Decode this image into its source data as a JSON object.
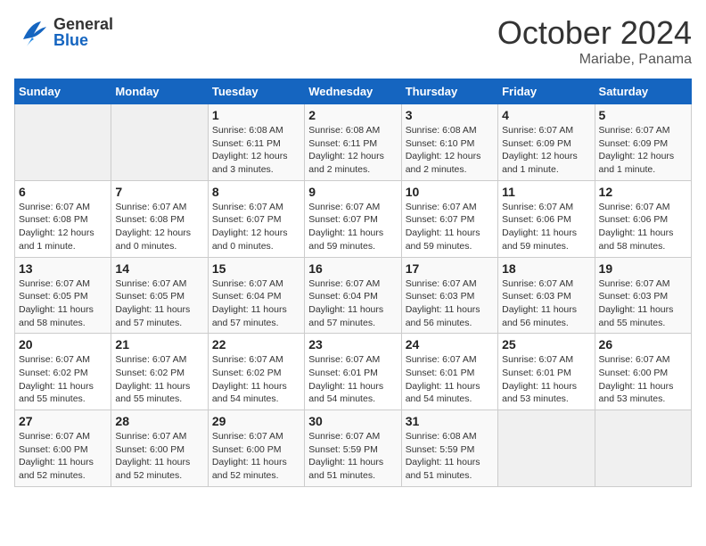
{
  "header": {
    "logo_general": "General",
    "logo_blue": "Blue",
    "month_title": "October 2024",
    "location": "Mariabe, Panama"
  },
  "days_of_week": [
    "Sunday",
    "Monday",
    "Tuesday",
    "Wednesday",
    "Thursday",
    "Friday",
    "Saturday"
  ],
  "weeks": [
    [
      {
        "day": "",
        "detail": ""
      },
      {
        "day": "",
        "detail": ""
      },
      {
        "day": "1",
        "detail": "Sunrise: 6:08 AM\nSunset: 6:11 PM\nDaylight: 12 hours\nand 3 minutes."
      },
      {
        "day": "2",
        "detail": "Sunrise: 6:08 AM\nSunset: 6:11 PM\nDaylight: 12 hours\nand 2 minutes."
      },
      {
        "day": "3",
        "detail": "Sunrise: 6:08 AM\nSunset: 6:10 PM\nDaylight: 12 hours\nand 2 minutes."
      },
      {
        "day": "4",
        "detail": "Sunrise: 6:07 AM\nSunset: 6:09 PM\nDaylight: 12 hours\nand 1 minute."
      },
      {
        "day": "5",
        "detail": "Sunrise: 6:07 AM\nSunset: 6:09 PM\nDaylight: 12 hours\nand 1 minute."
      }
    ],
    [
      {
        "day": "6",
        "detail": "Sunrise: 6:07 AM\nSunset: 6:08 PM\nDaylight: 12 hours\nand 1 minute."
      },
      {
        "day": "7",
        "detail": "Sunrise: 6:07 AM\nSunset: 6:08 PM\nDaylight: 12 hours\nand 0 minutes."
      },
      {
        "day": "8",
        "detail": "Sunrise: 6:07 AM\nSunset: 6:07 PM\nDaylight: 12 hours\nand 0 minutes."
      },
      {
        "day": "9",
        "detail": "Sunrise: 6:07 AM\nSunset: 6:07 PM\nDaylight: 11 hours\nand 59 minutes."
      },
      {
        "day": "10",
        "detail": "Sunrise: 6:07 AM\nSunset: 6:07 PM\nDaylight: 11 hours\nand 59 minutes."
      },
      {
        "day": "11",
        "detail": "Sunrise: 6:07 AM\nSunset: 6:06 PM\nDaylight: 11 hours\nand 59 minutes."
      },
      {
        "day": "12",
        "detail": "Sunrise: 6:07 AM\nSunset: 6:06 PM\nDaylight: 11 hours\nand 58 minutes."
      }
    ],
    [
      {
        "day": "13",
        "detail": "Sunrise: 6:07 AM\nSunset: 6:05 PM\nDaylight: 11 hours\nand 58 minutes."
      },
      {
        "day": "14",
        "detail": "Sunrise: 6:07 AM\nSunset: 6:05 PM\nDaylight: 11 hours\nand 57 minutes."
      },
      {
        "day": "15",
        "detail": "Sunrise: 6:07 AM\nSunset: 6:04 PM\nDaylight: 11 hours\nand 57 minutes."
      },
      {
        "day": "16",
        "detail": "Sunrise: 6:07 AM\nSunset: 6:04 PM\nDaylight: 11 hours\nand 57 minutes."
      },
      {
        "day": "17",
        "detail": "Sunrise: 6:07 AM\nSunset: 6:03 PM\nDaylight: 11 hours\nand 56 minutes."
      },
      {
        "day": "18",
        "detail": "Sunrise: 6:07 AM\nSunset: 6:03 PM\nDaylight: 11 hours\nand 56 minutes."
      },
      {
        "day": "19",
        "detail": "Sunrise: 6:07 AM\nSunset: 6:03 PM\nDaylight: 11 hours\nand 55 minutes."
      }
    ],
    [
      {
        "day": "20",
        "detail": "Sunrise: 6:07 AM\nSunset: 6:02 PM\nDaylight: 11 hours\nand 55 minutes."
      },
      {
        "day": "21",
        "detail": "Sunrise: 6:07 AM\nSunset: 6:02 PM\nDaylight: 11 hours\nand 55 minutes."
      },
      {
        "day": "22",
        "detail": "Sunrise: 6:07 AM\nSunset: 6:02 PM\nDaylight: 11 hours\nand 54 minutes."
      },
      {
        "day": "23",
        "detail": "Sunrise: 6:07 AM\nSunset: 6:01 PM\nDaylight: 11 hours\nand 54 minutes."
      },
      {
        "day": "24",
        "detail": "Sunrise: 6:07 AM\nSunset: 6:01 PM\nDaylight: 11 hours\nand 54 minutes."
      },
      {
        "day": "25",
        "detail": "Sunrise: 6:07 AM\nSunset: 6:01 PM\nDaylight: 11 hours\nand 53 minutes."
      },
      {
        "day": "26",
        "detail": "Sunrise: 6:07 AM\nSunset: 6:00 PM\nDaylight: 11 hours\nand 53 minutes."
      }
    ],
    [
      {
        "day": "27",
        "detail": "Sunrise: 6:07 AM\nSunset: 6:00 PM\nDaylight: 11 hours\nand 52 minutes."
      },
      {
        "day": "28",
        "detail": "Sunrise: 6:07 AM\nSunset: 6:00 PM\nDaylight: 11 hours\nand 52 minutes."
      },
      {
        "day": "29",
        "detail": "Sunrise: 6:07 AM\nSunset: 6:00 PM\nDaylight: 11 hours\nand 52 minutes."
      },
      {
        "day": "30",
        "detail": "Sunrise: 6:07 AM\nSunset: 5:59 PM\nDaylight: 11 hours\nand 51 minutes."
      },
      {
        "day": "31",
        "detail": "Sunrise: 6:08 AM\nSunset: 5:59 PM\nDaylight: 11 hours\nand 51 minutes."
      },
      {
        "day": "",
        "detail": ""
      },
      {
        "day": "",
        "detail": ""
      }
    ]
  ]
}
